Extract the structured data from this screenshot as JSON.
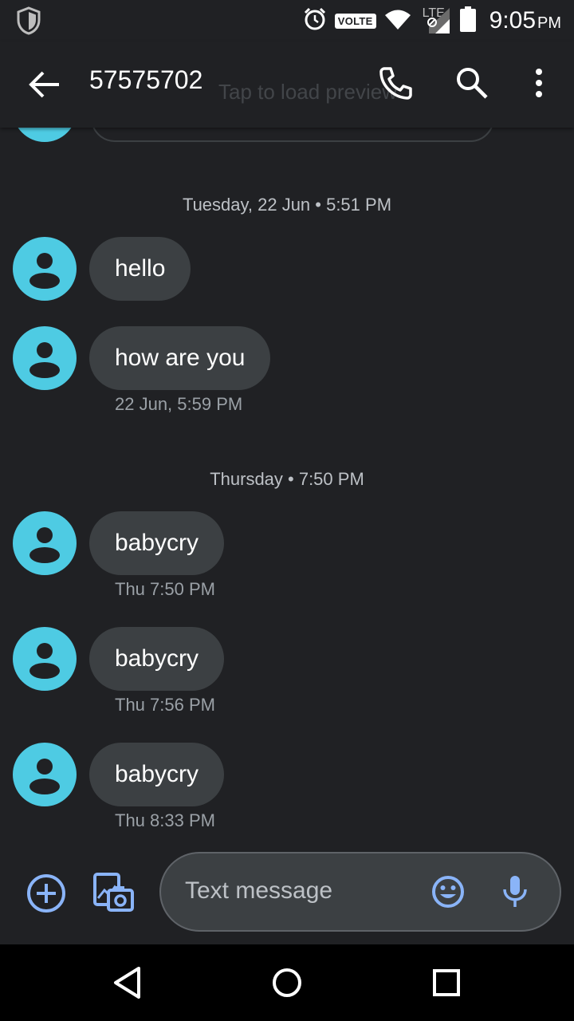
{
  "status_bar": {
    "volte": "VOLTE",
    "network": "LTE",
    "time": "9:05",
    "ampm": "PM"
  },
  "app_bar": {
    "title": "57575702",
    "ghost_text": "Tap to load preview"
  },
  "separators": [
    {
      "text": "Tuesday, 22 Jun • 5:51 PM"
    },
    {
      "text": "Thursday • 7:50 PM"
    }
  ],
  "messages": [
    {
      "text": "hello",
      "meta": ""
    },
    {
      "text": "how are you",
      "meta": "22 Jun, 5:59 PM"
    },
    {
      "text": "babycry",
      "meta": "Thu 7:50 PM"
    },
    {
      "text": "babycry",
      "meta": "Thu 7:56 PM"
    },
    {
      "text": "babycry",
      "meta": "Thu 8:33 PM"
    }
  ],
  "composer": {
    "placeholder": "Text message"
  },
  "colors": {
    "background": "#202124",
    "bubble": "#3c4043",
    "avatar": "#4ecbe3",
    "accent": "#8ab4f8"
  }
}
